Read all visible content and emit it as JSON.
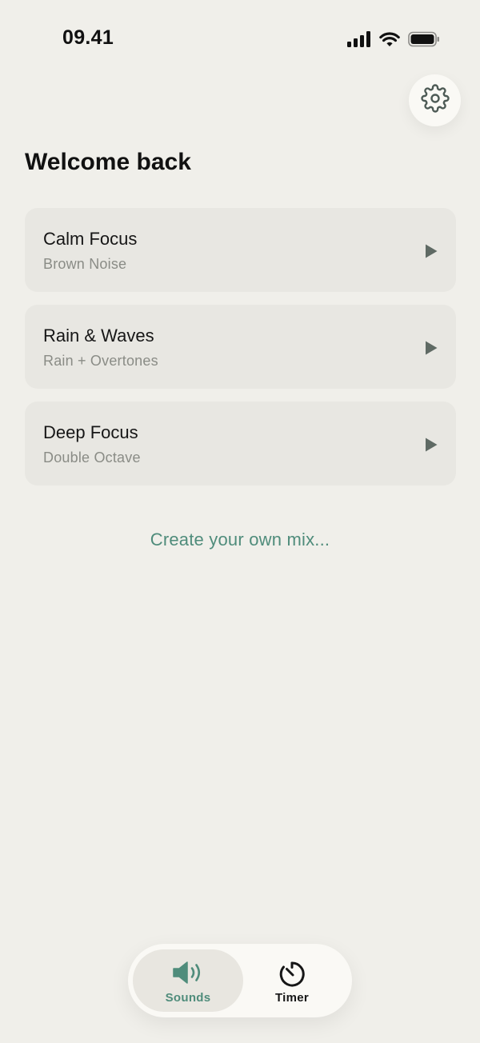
{
  "status_bar": {
    "time": "09.41",
    "icons": [
      "cellular-signal-icon",
      "wifi-icon",
      "battery-icon"
    ]
  },
  "header": {
    "settings_icon": "gear-icon",
    "title": "Welcome back"
  },
  "presets": [
    {
      "title": "Calm Focus",
      "subtitle": "Brown Noise",
      "action_icon": "play-icon"
    },
    {
      "title": "Rain & Waves",
      "subtitle": "Rain + Overtones",
      "action_icon": "play-icon"
    },
    {
      "title": "Deep Focus",
      "subtitle": "Double Octave",
      "action_icon": "play-icon"
    }
  ],
  "create_mix_label": "Create your own mix...",
  "tab_bar": {
    "tabs": [
      {
        "label": "Sounds",
        "icon": "speaker-icon",
        "active": true
      },
      {
        "label": "Timer",
        "icon": "timer-icon",
        "active": false
      }
    ]
  },
  "colors": {
    "background": "#f0efea",
    "card": "#e8e7e2",
    "accent": "#4f8c7b",
    "text": "#161616",
    "subtle_text": "#8a8c86"
  }
}
